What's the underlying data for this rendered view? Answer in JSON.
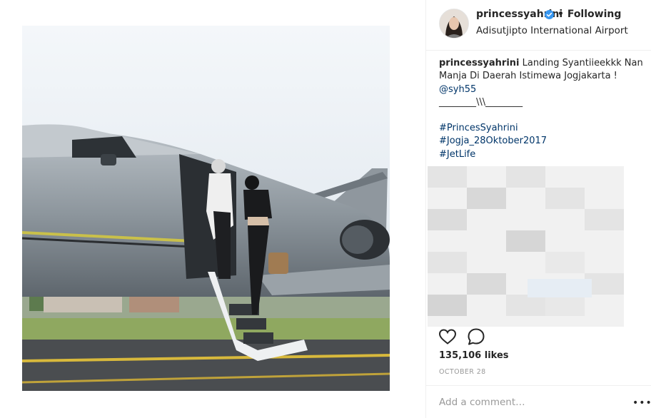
{
  "post": {
    "username": "princessyahrini",
    "follow_state": "• Following",
    "location": "Adisutjipto International Airport"
  },
  "caption": {
    "username": "princessyahrini",
    "text": "Landing Syantiieekkk Nan Manja Di Daerah Istimewa Jogjakarta !",
    "mention": "@syh55",
    "separator": "________\\\\\\________",
    "hashtags": [
      "#PrincesSyahrini",
      "#Jogja_28Oktober2017",
      "#JetLife"
    ]
  },
  "stats": {
    "likes": "135,106 likes",
    "date": "OCTOBER 28"
  },
  "comment_box": {
    "placeholder": "Add a comment…",
    "more": "•••"
  },
  "icons": {
    "verified": "verified-badge-icon",
    "like": "heart-icon",
    "comment": "comment-bubble-icon",
    "more": "more-options-icon"
  },
  "colors": {
    "hashtag": "#003569",
    "verified": "#3897f0",
    "muted": "#999999"
  }
}
